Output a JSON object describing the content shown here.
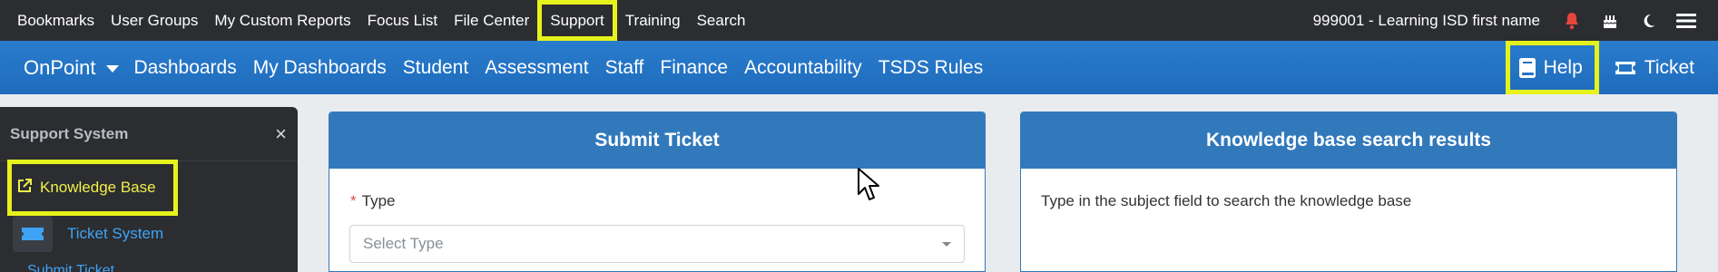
{
  "topbar": {
    "items": [
      "Bookmarks",
      "User Groups",
      "My Custom Reports",
      "Focus List",
      "File Center",
      "Support",
      "Training",
      "Search"
    ],
    "district": "999001 - Learning ISD first name",
    "icons": [
      "bell-icon",
      "cake-icon",
      "moon-icon",
      "hamburger-menu-icon"
    ],
    "bell_color": "#e8453c"
  },
  "mainnav": {
    "brand": "OnPoint",
    "items": [
      "Dashboards",
      "My Dashboards",
      "Student",
      "Assessment",
      "Staff",
      "Finance",
      "Accountability",
      "TSDS Rules"
    ],
    "help_label": "Help",
    "ticket_label": "Ticket"
  },
  "sidebar": {
    "title": "Support System",
    "close": "×",
    "kb_label": "Knowledge Base",
    "ts_label": "Ticket System",
    "next_label": "Submit Ticket"
  },
  "submit_card": {
    "title": "Submit Ticket",
    "required_mark": "*",
    "type_label": "Type",
    "type_placeholder": "Select Type"
  },
  "kb_card": {
    "title": "Knowledge base search results",
    "hint": "Type in the subject field to search the knowledge base"
  },
  "colors": {
    "topbar": "#2b2d31",
    "nav_blue": "#2474c4",
    "highlight": "#e6f21b",
    "link_blue": "#3fa3f5"
  }
}
